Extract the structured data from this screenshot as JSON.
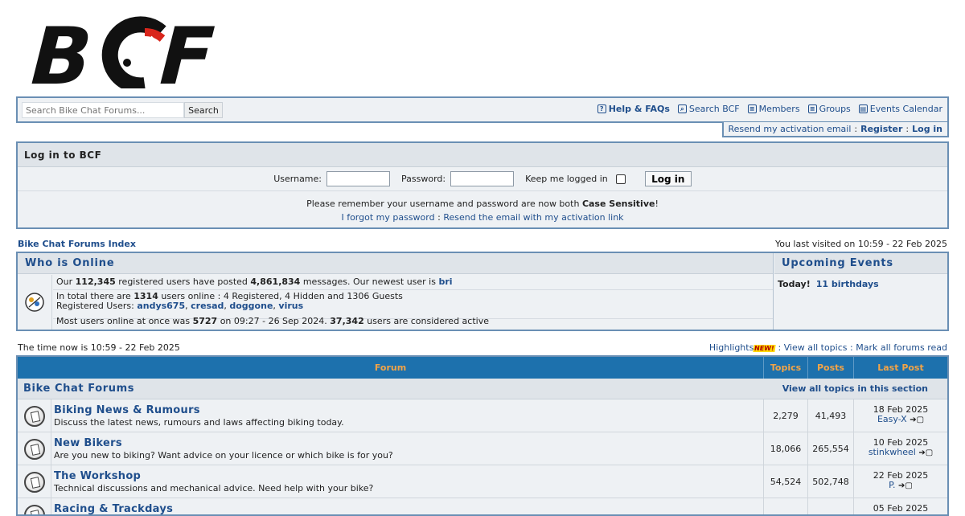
{
  "logo": {
    "text": "BCF"
  },
  "search": {
    "placeholder": "Search Bike Chat Forums...",
    "button": "Search"
  },
  "nav": {
    "help": "Help & FAQs",
    "search": "Search BCF",
    "members": "Members",
    "groups": "Groups",
    "calendar": "Events Calendar"
  },
  "subnav": {
    "resend": "Resend my activation email",
    "sep": ":",
    "register": "Register",
    "login": "Log in"
  },
  "login": {
    "title": "Log in to BCF",
    "username_label": "Username:",
    "password_label": "Password:",
    "keep_label": "Keep me logged in",
    "button": "Log in",
    "notice_prefix": "Please remember your username and password are now both",
    "notice_bold": "Case Sensitive",
    "notice_suffix": "!",
    "forgot": "I forgot my password",
    "resend": "Resend the email with my activation link",
    "sep": ":"
  },
  "breadcrumb": "Bike Chat Forums Index",
  "last_visit": "You last visited on 10:59 - 22 Feb 2025",
  "who_online": {
    "title": "Who is Online",
    "l1_a": "Our",
    "users_count": "112,345",
    "l1_b": "registered users have posted",
    "messages_count": "4,861,834",
    "l1_c": "messages. Our newest user is",
    "newest_user": "bri",
    "l2_a": "In total there are",
    "online_count": "1314",
    "l2_b": "users online : 4 Registered, 4 Hidden and 1306 Guests",
    "registered_label": "Registered Users:",
    "registered_users": [
      "andys675",
      "cresad",
      "doggone",
      "virus"
    ],
    "l3_a": "Most users online at once was",
    "max_users": "5727",
    "l3_b": "on 09:27 - 26 Sep 2024.",
    "active_count": "37,342",
    "l3_c": "users are considered active"
  },
  "events": {
    "title": "Upcoming Events",
    "today": "Today!",
    "birthdays": "11 birthdays"
  },
  "time_now": "The time now is 10:59 - 22 Feb 2025",
  "top_links": {
    "highlights": "Highlights",
    "new_tag": "NEW!",
    "sep": ":",
    "view_all": "View all topics",
    "mark_read": "Mark all forums read"
  },
  "forum_table": {
    "headers": {
      "forum": "Forum",
      "topics": "Topics",
      "posts": "Posts",
      "last_post": "Last Post"
    },
    "section": {
      "title": "Bike Chat Forums",
      "view_all": "View all topics in this section"
    },
    "rows": [
      {
        "name": "Biking News & Rumours",
        "desc": "Discuss the latest news, rumours and laws affecting biking today.",
        "topics": "2,279",
        "posts": "41,493",
        "last_date": "18 Feb 2025",
        "last_user": "Easy-X"
      },
      {
        "name": "New Bikers",
        "desc": "Are you new to biking? Want advice on your licence or which bike is for you?",
        "topics": "18,066",
        "posts": "265,554",
        "last_date": "10 Feb 2025",
        "last_user": "stinkwheel"
      },
      {
        "name": "The Workshop",
        "desc": "Technical discussions and mechanical advice. Need help with your bike?",
        "topics": "54,524",
        "posts": "502,748",
        "last_date": "22 Feb 2025",
        "last_user": "P."
      },
      {
        "name": "Racing & Trackdays",
        "desc": "",
        "topics": "",
        "posts": "",
        "last_date": "05 Feb 2025",
        "last_user": ""
      }
    ]
  }
}
